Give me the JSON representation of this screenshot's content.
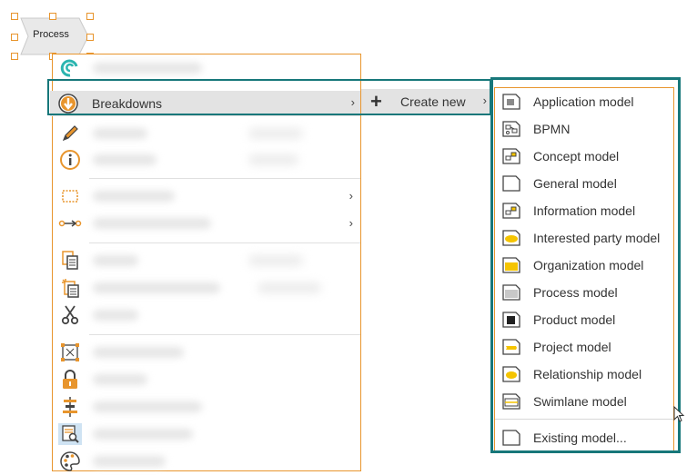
{
  "canvas": {
    "process_shape_label": "Process"
  },
  "context_menu": {
    "breakdowns_label": "Breakdowns",
    "breakdowns_chevron": "›",
    "submenu_chevron_1": "›",
    "submenu_chevron_2": "›"
  },
  "breakdowns_submenu": {
    "create_new_label": "Create new",
    "create_new_chevron": "›"
  },
  "create_new_submenu": {
    "items": [
      {
        "label": "Application model",
        "icon": "application-model-icon"
      },
      {
        "label": "BPMN",
        "icon": "bpmn-icon"
      },
      {
        "label": "Concept model",
        "icon": "concept-model-icon"
      },
      {
        "label": "General model",
        "icon": "general-model-icon"
      },
      {
        "label": "Information model",
        "icon": "information-model-icon"
      },
      {
        "label": "Interested party model",
        "icon": "interested-party-model-icon"
      },
      {
        "label": "Organization model",
        "icon": "organization-model-icon"
      },
      {
        "label": "Process model",
        "icon": "process-model-icon"
      },
      {
        "label": "Product model",
        "icon": "product-model-icon"
      },
      {
        "label": "Project model",
        "icon": "project-model-icon"
      },
      {
        "label": "Relationship model",
        "icon": "relationship-model-icon"
      },
      {
        "label": "Swimlane model",
        "icon": "swimlane-model-icon"
      }
    ],
    "existing_model_label": "Existing model..."
  },
  "colors": {
    "accent_orange": "#e8952d",
    "highlight_teal": "#17777a",
    "hover_gray": "#e3e3e3",
    "model_yellow": "#f5c400"
  }
}
